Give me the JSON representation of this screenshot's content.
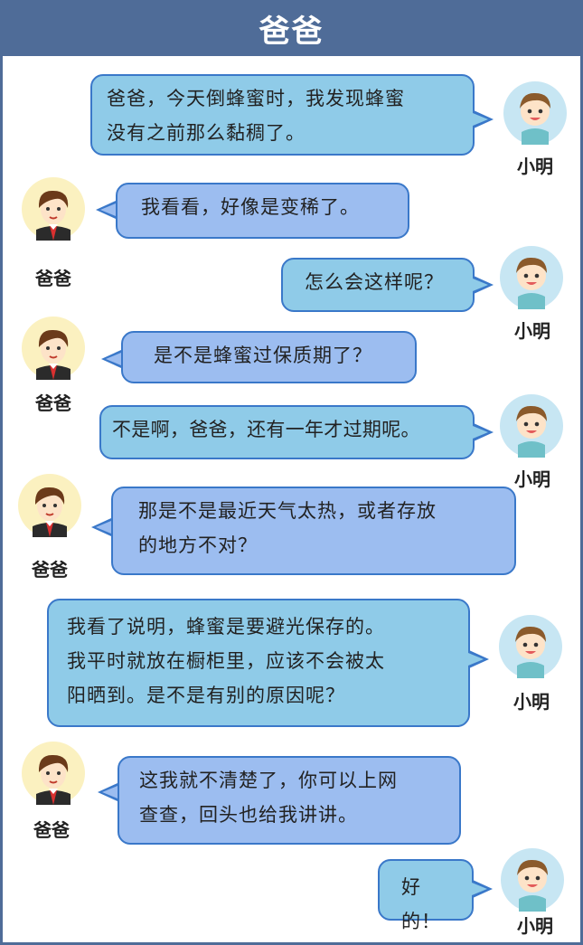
{
  "header": {
    "title": "爸爸"
  },
  "speakers": {
    "kid": "小明",
    "dad": "爸爸"
  },
  "messages": [
    {
      "lines": [
        "爸爸，今天倒蜂蜜时，我发现蜂蜜",
        "没有之前那么黏稠了。"
      ]
    },
    {
      "lines": [
        "我看看，好像是变稀了。"
      ]
    },
    {
      "lines": [
        "怎么会这样呢？"
      ]
    },
    {
      "lines": [
        "是不是蜂蜜过保质期了？"
      ]
    },
    {
      "lines": [
        "不是啊，爸爸，还有一年才过期呢。"
      ]
    },
    {
      "lines": [
        "那是不是最近天气太热，或者存放",
        "的地方不对？"
      ]
    },
    {
      "lines": [
        "我看了说明，蜂蜜是要避光保存的。",
        "我平时就放在橱柜里，应该不会被太",
        "阳晒到。是不是有别的原因呢？"
      ]
    },
    {
      "lines": [
        "这我就不清楚了，你可以上网",
        "查查，回头也给我讲讲。"
      ]
    },
    {
      "lines": [
        "好的！"
      ]
    }
  ],
  "colors": {
    "header_bg": "#4f6c98",
    "kid_bubble": "#8fcbe8",
    "dad_bubble": "#9cbdf0",
    "bubble_border": "#3a78c9"
  }
}
